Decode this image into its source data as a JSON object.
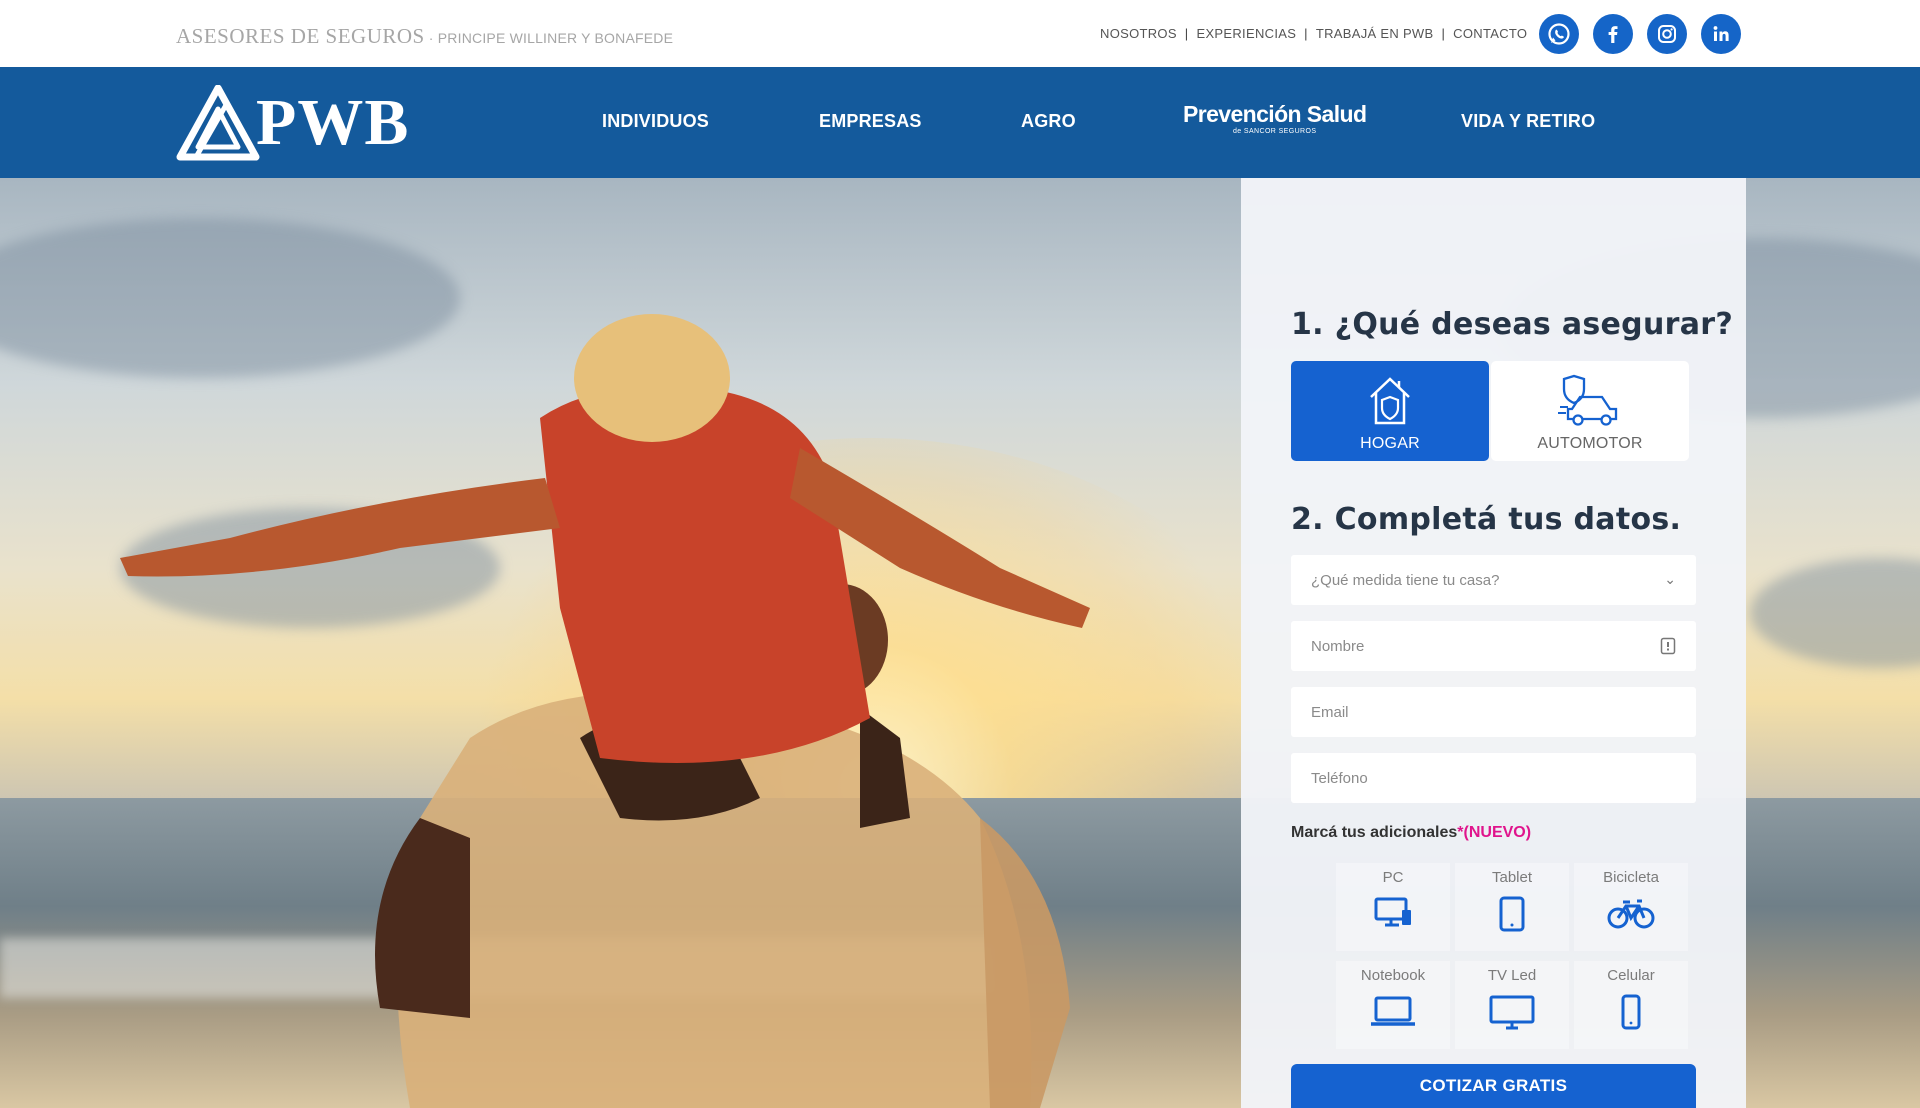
{
  "topbar": {
    "brand_main": "ASESORES DE SEGUROS",
    "brand_sub": " · PRINCIPE WILLINER Y BONAFEDE",
    "links": [
      "NOSOTROS",
      "EXPERIENCIAS",
      "TRABAJÁ EN PWB",
      "CONTACTO"
    ],
    "socials": [
      "whatsapp-icon",
      "facebook-icon",
      "instagram-icon",
      "linkedin-icon"
    ]
  },
  "nav": {
    "logo_text": "PWB",
    "items": [
      "INDIVIDUOS",
      "EMPRESAS",
      "AGRO",
      "VIDA Y RETIRO"
    ],
    "prevencion_title": "Prevención Salud",
    "prevencion_sub": "de SANCOR SEGUROS"
  },
  "form": {
    "step1_title": "1. ¿Qué deseas asegurar?",
    "options": [
      {
        "label": "HOGAR",
        "icon": "house-shield-icon",
        "selected": true
      },
      {
        "label": "AUTOMOTOR",
        "icon": "car-shield-icon",
        "selected": false
      }
    ],
    "step2_title": "2. Completá tus datos.",
    "fields": {
      "size_select": "¿Qué medida tiene tu casa?",
      "name": "Nombre",
      "email": "Email",
      "phone": "Teléfono"
    },
    "additionals_label": "Marcá tus adicionales",
    "additionals_new": "*(NUEVO)",
    "additionals": [
      {
        "label": "PC",
        "icon": "pc-icon"
      },
      {
        "label": "Tablet",
        "icon": "tablet-icon"
      },
      {
        "label": "Bicicleta",
        "icon": "bicycle-icon"
      },
      {
        "label": "Notebook",
        "icon": "notebook-icon"
      },
      {
        "label": "TV Led",
        "icon": "tv-icon"
      },
      {
        "label": "Celular",
        "icon": "phone-icon"
      }
    ],
    "cta": "COTIZAR GRATIS"
  },
  "colors": {
    "nav_blue": "#145a9c",
    "accent_blue": "#1562d0",
    "new_badge": "#e0148c"
  }
}
